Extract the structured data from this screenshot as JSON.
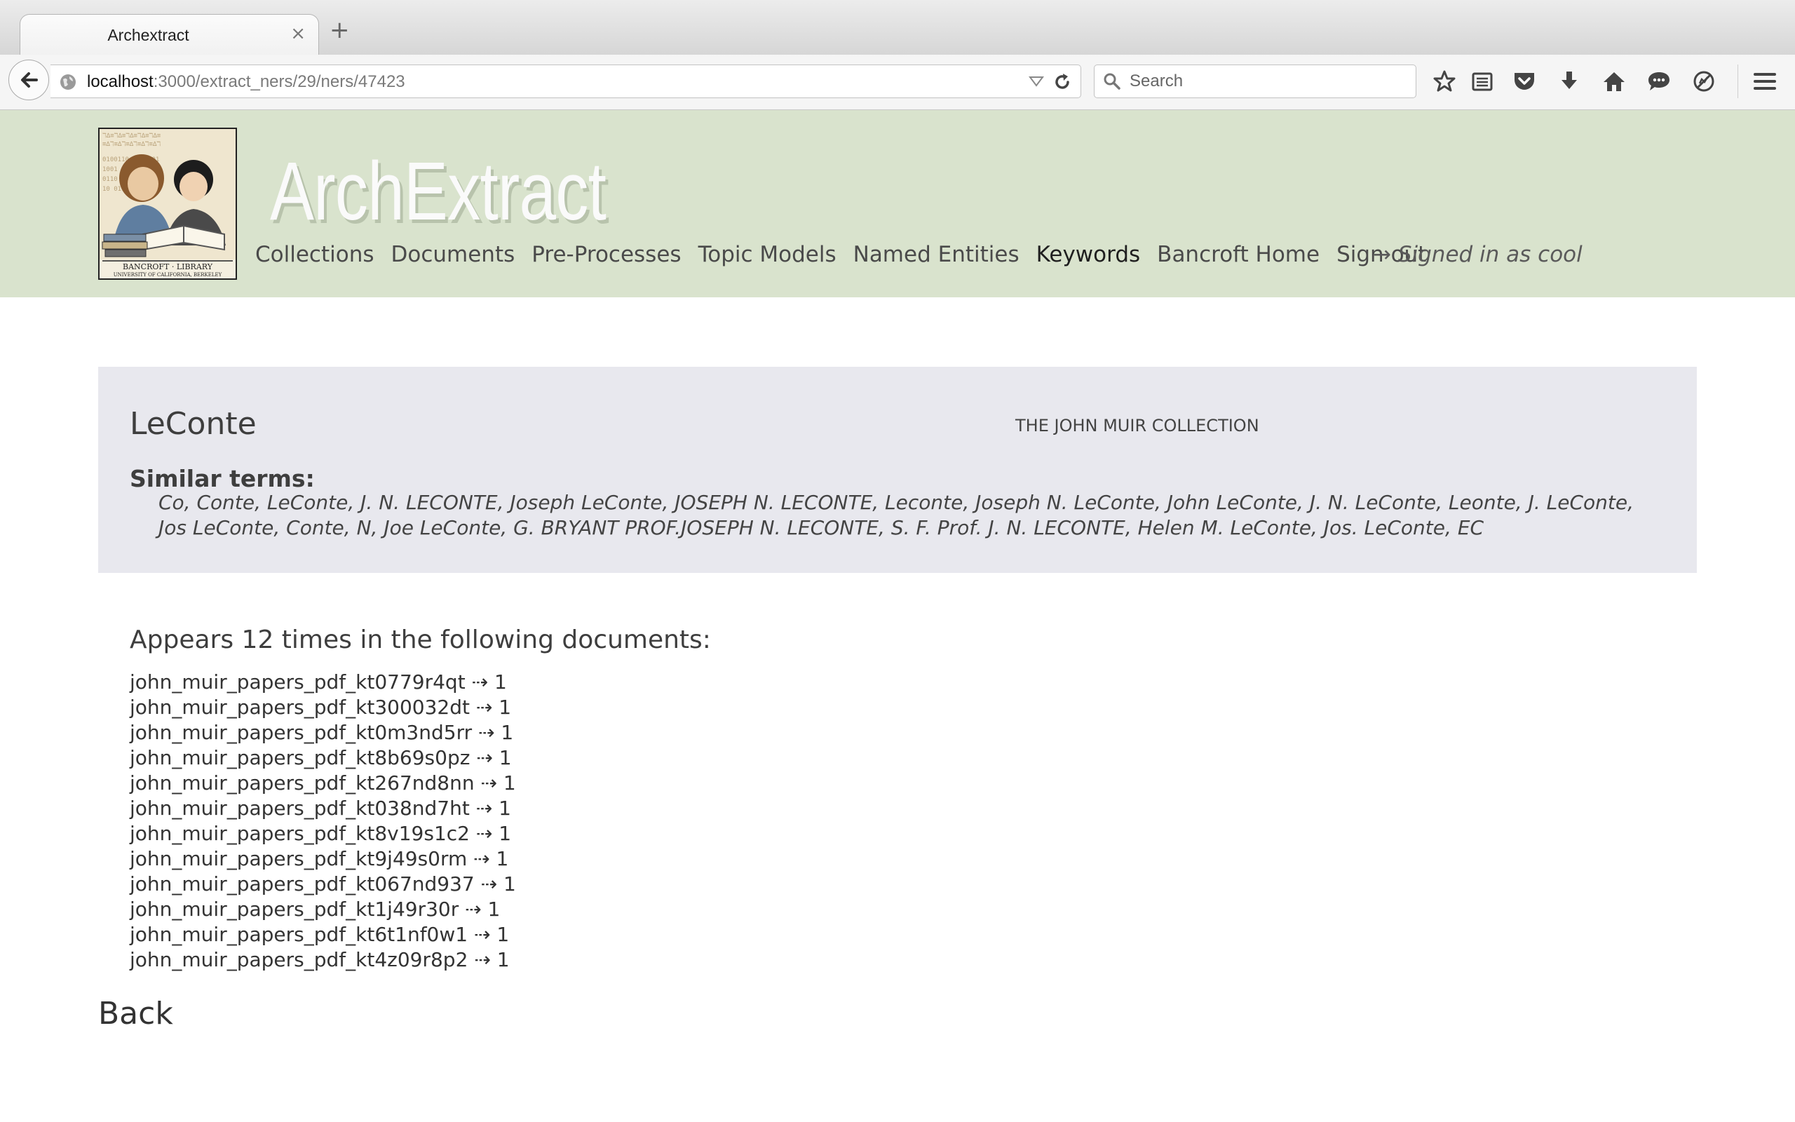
{
  "browser": {
    "tab_title": "Archextract",
    "tab_close": "×",
    "new_tab": "+",
    "url_host": "localhost",
    "url_path": ":3000/extract_ners/29/ners/47423",
    "search_placeholder": "Search"
  },
  "header": {
    "site_title": "ArchExtract",
    "nav": [
      "Collections",
      "Documents",
      "Pre-Processes",
      "Topic Models",
      "Named Entities",
      "Keywords",
      "Bancroft Home",
      "Sign out"
    ],
    "signed_in": "→ Signed in as cool"
  },
  "entity": {
    "name": "LeConte",
    "collection": "THE JOHN MUIR COLLECTION",
    "similar_label": "Similar terms:",
    "similar_terms": "Co, Conte, LeConte, J. N. LECONTE, Joseph LeConte, JOSEPH N. LECONTE, Leconte, Joseph N. LeConte, John LeConte, J. N. LeConte, Leonte, J. LeConte, Jos LeConte, Conte, N, Joe LeConte, G. BRYANT PROF.JOSEPH N. LECONTE, S. F. Prof. J. N. LECONTE, Helen M. LeConte, Jos. LeConte, EC"
  },
  "appears_heading": "Appears 12 times in the following documents:",
  "documents": [
    {
      "name": "john_muir_papers_pdf_kt0779r4qt",
      "arrow": "⇢",
      "count": "1"
    },
    {
      "name": "john_muir_papers_pdf_kt300032dt",
      "arrow": "⇢",
      "count": "1"
    },
    {
      "name": "john_muir_papers_pdf_kt0m3nd5rr",
      "arrow": "⇢",
      "count": "1"
    },
    {
      "name": "john_muir_papers_pdf_kt8b69s0pz",
      "arrow": "⇢",
      "count": "1"
    },
    {
      "name": "john_muir_papers_pdf_kt267nd8nn",
      "arrow": "⇢",
      "count": "1"
    },
    {
      "name": "john_muir_papers_pdf_kt038nd7ht",
      "arrow": "⇢",
      "count": "1"
    },
    {
      "name": "john_muir_papers_pdf_kt8v19s1c2",
      "arrow": "⇢",
      "count": "1"
    },
    {
      "name": "john_muir_papers_pdf_kt9j49s0rm",
      "arrow": "⇢",
      "count": "1"
    },
    {
      "name": "john_muir_papers_pdf_kt067nd937",
      "arrow": "⇢",
      "count": "1"
    },
    {
      "name": "john_muir_papers_pdf_kt1j49r30r",
      "arrow": "⇢",
      "count": "1"
    },
    {
      "name": "john_muir_papers_pdf_kt6t1nf0w1",
      "arrow": "⇢",
      "count": "1"
    },
    {
      "name": "john_muir_papers_pdf_kt4z09r8p2",
      "arrow": "⇢",
      "count": "1"
    }
  ],
  "back_label": "Back",
  "icons": {
    "back": "back-arrow-icon",
    "site": "globe-icon",
    "reload": "reload-icon",
    "search": "search-icon",
    "bookmark": "star-icon",
    "reading_list": "reading-list-icon",
    "pocket": "pocket-icon",
    "downloads": "download-icon",
    "home": "home-icon",
    "chat": "chat-icon",
    "tracking": "tracking-protection-icon",
    "menu": "hamburger-menu-icon"
  }
}
